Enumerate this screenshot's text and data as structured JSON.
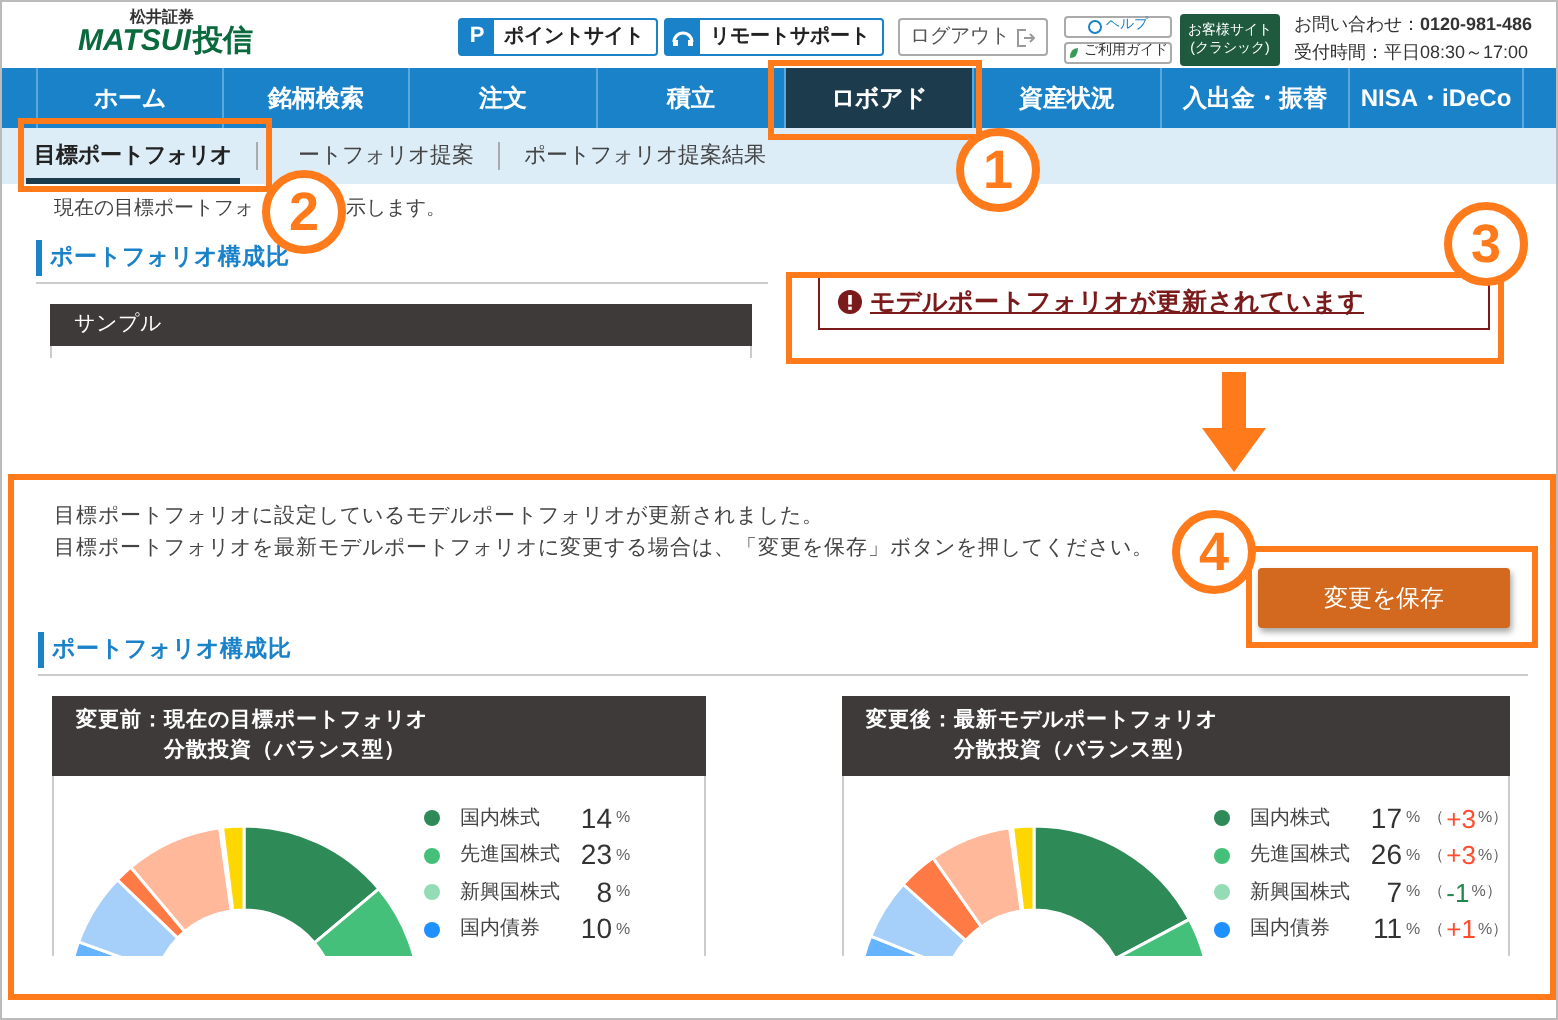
{
  "header": {
    "logo": {
      "company": "松井証券",
      "brand": "MATSUI",
      "suffix": "投信"
    },
    "buttons": [
      {
        "kind": "point",
        "icon": "P",
        "label": "ポイントサイト"
      },
      {
        "kind": "remote",
        "label": "リモートサポート"
      },
      {
        "kind": "logout",
        "label": "ログアウト"
      }
    ],
    "help": "ヘルプ",
    "guide": "ご利用ガイド",
    "classic": [
      "お客様サイト",
      "(クラシック)"
    ],
    "contact": "お問い合わせ：**0120-981-486**",
    "hours": "受付時間：平日08:30～17:00"
  },
  "nav": [
    {
      "label": "ホーム",
      "selected": false
    },
    {
      "label": "銘柄検索",
      "selected": false
    },
    {
      "label": "注文",
      "selected": false
    },
    {
      "label": "積立",
      "selected": false
    },
    {
      "label": "ロボアド",
      "selected": true
    },
    {
      "label": "資産状況",
      "selected": false
    },
    {
      "label": "入出金・振替",
      "selected": false
    },
    {
      "label": "NISA・iDeCo",
      "selected": false
    }
  ],
  "subnav": [
    {
      "label": "目標ポートフォリオ",
      "selected": true
    },
    {
      "label": "ートフォリオ提案",
      "selected": false
    },
    {
      "label": "ポートフォリオ提案結果",
      "selected": false
    }
  ],
  "intro": [
    "現在の目標ポートフォ",
    "示します。"
  ],
  "current_section": {
    "heading": "ポートフォリオ構成比",
    "table_header": "サンプル"
  },
  "alert": {
    "text": "モデルポートフォリオが更新されています"
  },
  "update_panel": {
    "messages": [
      "目標ポートフォリオに設定しているモデルポートフォリオが更新されました。",
      "目標ポートフォリオを最新モデルポートフォリオに変更する場合は、「変更を保存」ボタンを押してください。"
    ],
    "save_button": "変更を保存",
    "heading": "ポートフォリオ構成比",
    "cards": [
      {
        "title": "変更前：現在の目標ポートフォリオ",
        "subtitle": "分散投資（バランス型）",
        "items": [
          {
            "label": "国内株式",
            "color": "#2e8b57",
            "value": "14",
            "unit": "%"
          },
          {
            "label": "先進国株式",
            "color": "#44c07a",
            "value": "23",
            "unit": "%"
          },
          {
            "label": "新興国株式",
            "color": "#93dcb5",
            "value": "8",
            "unit": "%"
          },
          {
            "label": "国内債券",
            "color": "#1e90ff",
            "value": "10",
            "unit": "%"
          }
        ]
      },
      {
        "title": "変更後：最新モデルポートフォリオ",
        "subtitle": "分散投資（バランス型）",
        "items": [
          {
            "label": "国内株式",
            "color": "#2e8b57",
            "value": "17",
            "unit": "%",
            "change_open": "（",
            "change": {
              "text": "+3",
              "color": "#ff4d2e"
            },
            "change_close": "%）"
          },
          {
            "label": "先進国株式",
            "color": "#44c07a",
            "value": "26",
            "unit": "%",
            "change_open": "（",
            "change": {
              "text": "+3",
              "color": "#ff4d2e"
            },
            "change_close": "%）"
          },
          {
            "label": "新興国株式",
            "color": "#93dcb5",
            "value": "7",
            "unit": "%",
            "change_open": "（",
            "change": {
              "text": "-1",
              "color": "#1f8a4a"
            },
            "change_close": "%）"
          },
          {
            "label": "国内債券",
            "color": "#1e90ff",
            "value": "11",
            "unit": "%",
            "change_open": "（",
            "change": {
              "text": "+1",
              "color": "#ff4d2e"
            },
            "change_close": "%）"
          }
        ]
      }
    ]
  },
  "annotations": [
    "1",
    "2",
    "3",
    "4"
  ]
}
